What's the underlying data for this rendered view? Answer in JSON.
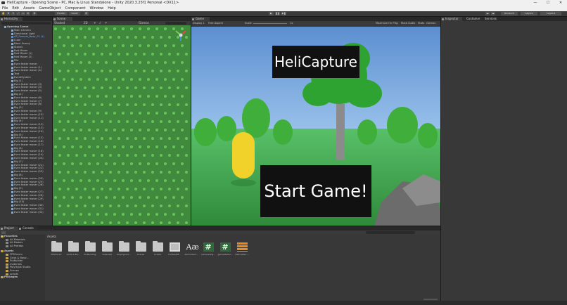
{
  "window": {
    "title": "HeliCapture - Opening Scene - PC, Mac & Linux Standalone - Unity 2020.3.25f1 Personal <DX11>",
    "min": "—",
    "max": "☐",
    "close": "✕"
  },
  "menu": [
    "File",
    "Edit",
    "Assets",
    "GameObject",
    "Component",
    "Window",
    "Help"
  ],
  "toolbar": {
    "center": "Center",
    "local": "Local",
    "account": "Account",
    "layers": "Layers",
    "layout": "Layout"
  },
  "hierarchy": {
    "tab": "Hierarchy",
    "scene": "Opening Scene",
    "items": [
      {
        "label": "Main Camera",
        "prefab": false
      },
      {
        "label": "Directional Light",
        "prefab": false
      },
      {
        "label": "AP_Sample_Base_01 (1)",
        "prefab": true
      },
      {
        "label": "Cube",
        "prefab": false
      },
      {
        "label": "Basic Enemy",
        "prefab": false
      },
      {
        "label": "Stones",
        "prefab": false
      },
      {
        "label": "Fast Mover",
        "prefab": false
      },
      {
        "label": "Fast Mover (1)",
        "prefab": false
      },
      {
        "label": "Fast Mover (2)",
        "prefab": false
      },
      {
        "label": "Pile",
        "prefab": false
      },
      {
        "label": "Even faster mover",
        "prefab": false
      },
      {
        "label": "Even faster mover (1)",
        "prefab": false
      },
      {
        "label": "Even faster mover (2)",
        "prefab": false
      },
      {
        "label": "Text",
        "prefab": false
      },
      {
        "label": "EventSystem",
        "prefab": false
      },
      {
        "label": "Big (1)",
        "prefab": false
      },
      {
        "label": "Even faster mover (3)",
        "prefab": false
      },
      {
        "label": "Even faster mover (4)",
        "prefab": false
      },
      {
        "label": "Even faster mover (5)",
        "prefab": false
      },
      {
        "label": "Big (2)",
        "prefab": false
      },
      {
        "label": "Even faster mover (6)",
        "prefab": false
      },
      {
        "label": "Even faster mover (7)",
        "prefab": false
      },
      {
        "label": "Even faster mover (8)",
        "prefab": false
      },
      {
        "label": "Big (3)",
        "prefab": false
      },
      {
        "label": "Even faster mover (9)",
        "prefab": false
      },
      {
        "label": "Even faster mover (10)",
        "prefab": false
      },
      {
        "label": "Even faster mover (11)",
        "prefab": false
      },
      {
        "label": "Big (4)",
        "prefab": false
      },
      {
        "label": "Even faster mover (12)",
        "prefab": false
      },
      {
        "label": "Even faster mover (13)",
        "prefab": false
      },
      {
        "label": "Even faster mover (14)",
        "prefab": false
      },
      {
        "label": "Big (5)",
        "prefab": false
      },
      {
        "label": "Even faster mover (15)",
        "prefab": false
      },
      {
        "label": "Even faster mover (16)",
        "prefab": false
      },
      {
        "label": "Even faster mover (17)",
        "prefab": false
      },
      {
        "label": "Big (6)",
        "prefab": false
      },
      {
        "label": "Even faster mover (18)",
        "prefab": false
      },
      {
        "label": "Even faster mover (19)",
        "prefab": false
      },
      {
        "label": "Even faster mover (20)",
        "prefab": false
      },
      {
        "label": "Big (7)",
        "prefab": false
      },
      {
        "label": "Even faster mover (21)",
        "prefab": false
      },
      {
        "label": "Even faster mover (22)",
        "prefab": false
      },
      {
        "label": "Even faster mover (23)",
        "prefab": false
      },
      {
        "label": "Big (8)",
        "prefab": false
      },
      {
        "label": "Even faster mover (24)",
        "prefab": false
      },
      {
        "label": "Even faster mover (25)",
        "prefab": false
      },
      {
        "label": "Even faster mover (26)",
        "prefab": false
      },
      {
        "label": "Big (9)",
        "prefab": false
      },
      {
        "label": "Even faster mover (27)",
        "prefab": false
      },
      {
        "label": "Even faster mover (28)",
        "prefab": false
      },
      {
        "label": "Even faster mover (29)",
        "prefab": false
      },
      {
        "label": "Big (10)",
        "prefab": false
      },
      {
        "label": "Even faster mover (30)",
        "prefab": false
      },
      {
        "label": "Even faster mover (31)",
        "prefab": false
      },
      {
        "label": "Even faster mover (32)",
        "prefab": false
      }
    ]
  },
  "scene": {
    "tab": "Scene",
    "shading": "Shaded",
    "gizmos": "Gizmos"
  },
  "game": {
    "tab": "Game",
    "display": "Display 1",
    "aspect": "Free Aspect",
    "scale_label": "Scale",
    "scale_value": "1x",
    "maximize": "Maximize On Play",
    "mute": "Mute Audio",
    "stats": "Stats",
    "gizmos": "Gizmos",
    "title_text": "HeliCapture",
    "start_button": "Start Game!"
  },
  "inspector": {
    "tabs": [
      "Inspector",
      "Container",
      "Services"
    ]
  },
  "project": {
    "tabs": [
      "Project",
      "Console"
    ],
    "breadcrumb": "Assets",
    "favorites": {
      "label": "Favorites",
      "items": [
        "All Materials",
        "All Models",
        "All Prefabs"
      ]
    },
    "assets_root": "Assets",
    "asset_folders": [
      "FPSForum",
      "Grids & Basic...",
      "ProBuilder",
      "materials",
      "Polyrtype Studio",
      "Scenes",
      "scripts"
    ],
    "packages": "Packages",
    "assets": [
      {
        "label": "FPSForum",
        "kind": "folder"
      },
      {
        "label": "Grids & Ba...",
        "kind": "folder"
      },
      {
        "label": "ProBuilding",
        "kind": "folder"
      },
      {
        "label": "materials",
        "kind": "folder"
      },
      {
        "label": "Polyrtype S...",
        "kind": "folder"
      },
      {
        "label": "Scenes",
        "kind": "folder"
      },
      {
        "label": "scripts",
        "kind": "folder"
      },
      {
        "label": "TUTRIALM...",
        "kind": "material"
      },
      {
        "label": "AmmoSam...",
        "kind": "font"
      },
      {
        "label": "camerasing...",
        "kind": "script"
      },
      {
        "label": "gameStartsi...",
        "kind": "script"
      },
      {
        "label": "Helicopter-...",
        "kind": "stack"
      }
    ]
  }
}
